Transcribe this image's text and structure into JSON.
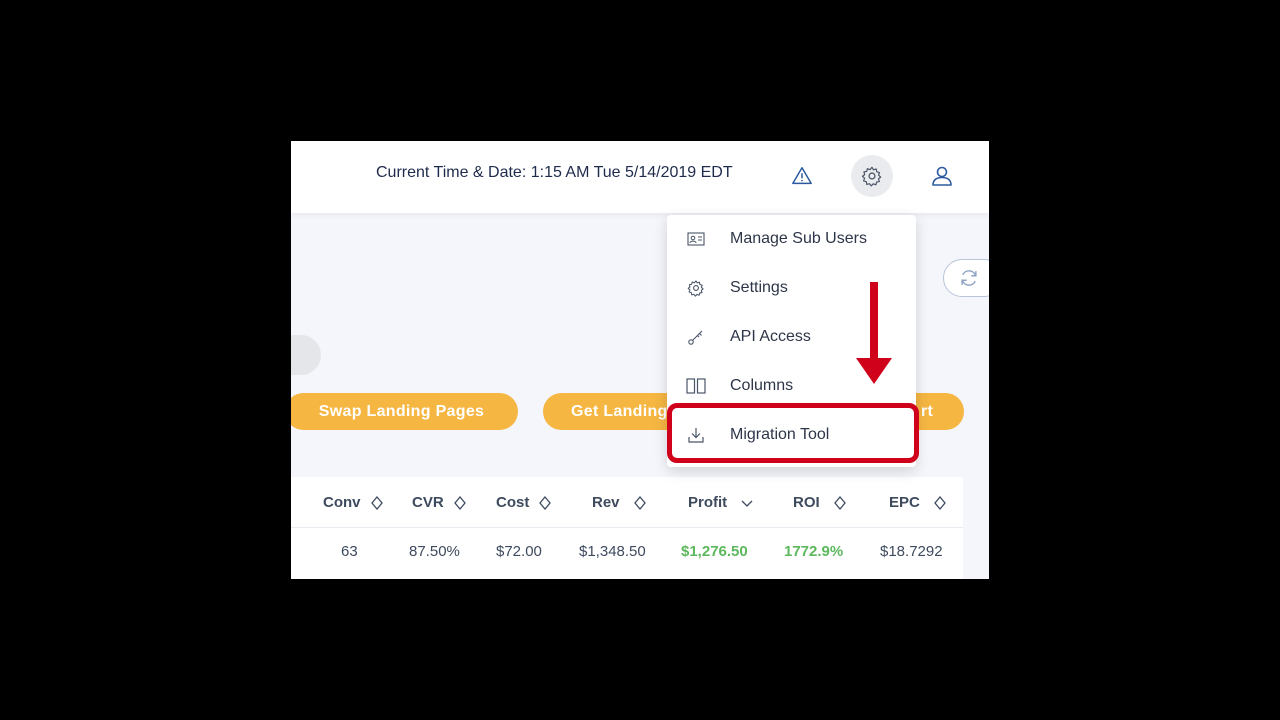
{
  "header": {
    "datetime": "Current Time & Date: 1:15 AM Tue 5/14/2019 EDT",
    "icons": [
      "warning-icon",
      "gear-icon",
      "user-icon"
    ]
  },
  "actions": {
    "swap_landing_pages": "Swap Landing Pages",
    "get_landing": "Get Landing",
    "third_button_partial": "rt"
  },
  "menu": {
    "items": [
      {
        "label": "Manage Sub Users",
        "icon": "id-card-icon"
      },
      {
        "label": "Settings",
        "icon": "gear-icon"
      },
      {
        "label": "API Access",
        "icon": "key-icon"
      },
      {
        "label": "Columns",
        "icon": "columns-icon"
      },
      {
        "label": "Migration Tool",
        "icon": "download-icon"
      }
    ]
  },
  "table": {
    "headers": [
      "Conv",
      "CVR",
      "Cost",
      "Rev",
      "Profit",
      "ROI",
      "EPC"
    ],
    "row": [
      "63",
      "87.50%",
      "$72.00",
      "$1,348.50",
      "$1,276.50",
      "1772.9%",
      "$18.7292"
    ]
  },
  "colors": {
    "accent_orange": "#f5b642",
    "highlight_red": "#d0021b",
    "positive_green": "#5cb85c",
    "text_dark": "#1f2b4d"
  }
}
